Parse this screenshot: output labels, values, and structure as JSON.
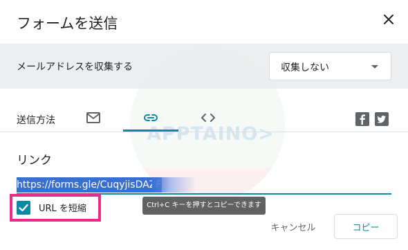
{
  "dialog": {
    "title": "フォームを送信",
    "close_icon": "close-icon"
  },
  "collect": {
    "label": "メールアドレスを収集する",
    "select_value": "収集しない"
  },
  "send_method": {
    "label": "送信方法",
    "tabs": [
      {
        "icon": "mail-icon",
        "selected": false
      },
      {
        "icon": "link-icon",
        "selected": true
      },
      {
        "icon": "embed-code-icon",
        "selected": false
      }
    ],
    "social": [
      {
        "icon": "facebook-icon"
      },
      {
        "icon": "twitter-icon"
      }
    ]
  },
  "link_section": {
    "heading": "リンク",
    "url": "https://forms.gle/CuqyjisDAZF",
    "tooltip": "Ctrl+C キーを押すとコピーできます",
    "shorten_label": "URL を短縮",
    "shorten_checked": true
  },
  "buttons": {
    "cancel": "キャンセル",
    "copy": "コピー"
  },
  "watermark": {
    "text": "APPTAINO>"
  },
  "colors": {
    "accent": "#0b8aa8",
    "highlight": "#ec2a8a",
    "selection": "#3a6fd2"
  }
}
